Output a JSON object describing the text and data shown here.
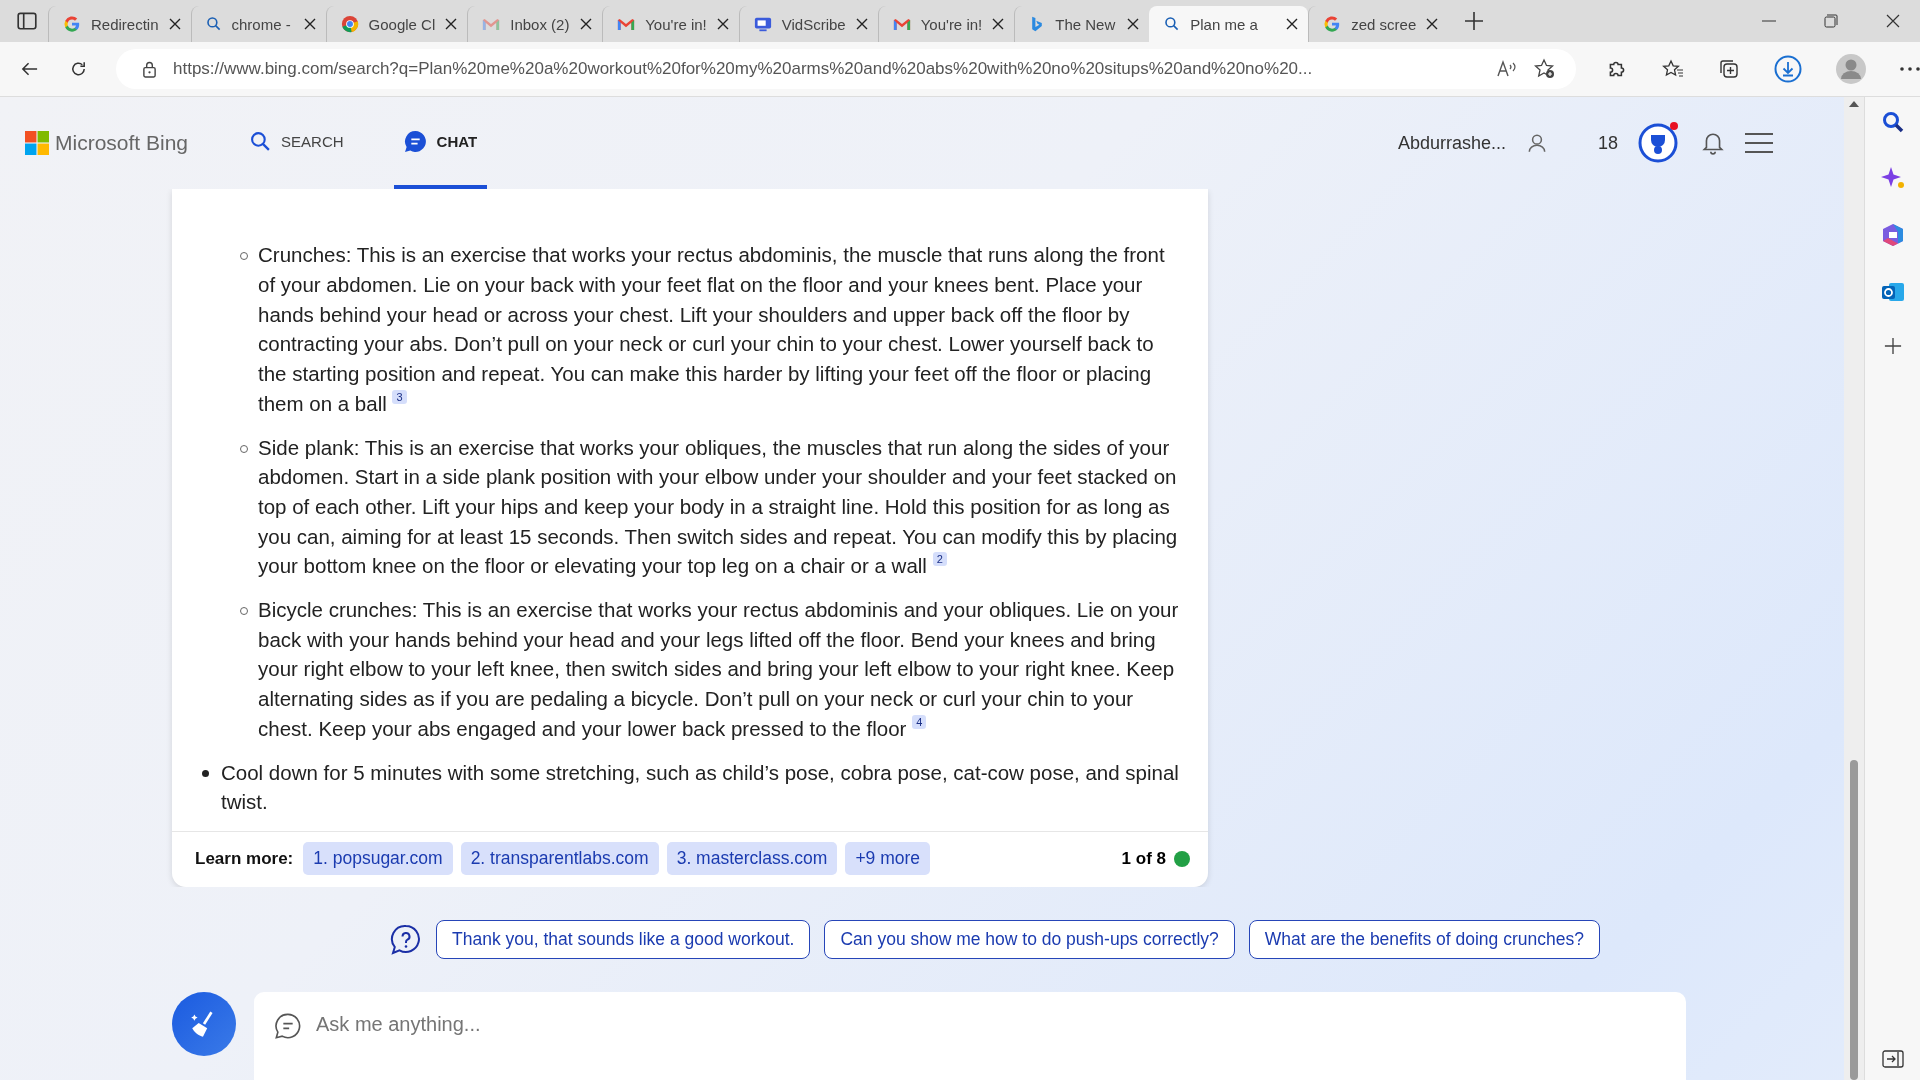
{
  "browser": {
    "tabs": [
      {
        "title": "Redirectin",
        "selected": false
      },
      {
        "title": "chrome -",
        "selected": false
      },
      {
        "title": "Google Cl",
        "selected": false
      },
      {
        "title": "Inbox (2)",
        "selected": false
      },
      {
        "title": "You're in!",
        "selected": false
      },
      {
        "title": "VidScribe",
        "selected": false
      },
      {
        "title": "You're in!",
        "selected": false
      },
      {
        "title": "The New",
        "selected": false
      },
      {
        "title": "Plan me a",
        "selected": true
      },
      {
        "title": "zed scree",
        "selected": false
      }
    ],
    "url": "https://www.bing.com/search?q=Plan%20me%20a%20workout%20for%20my%20arms%20and%20abs%20with%20no%20situps%20and%20no%20..."
  },
  "header": {
    "logo": "Microsoft Bing",
    "nav": [
      {
        "label": "SEARCH",
        "kind": "search",
        "selected": false
      },
      {
        "label": "CHAT",
        "kind": "chat",
        "selected": true
      }
    ],
    "user": "Abdurrashe...",
    "points": "18"
  },
  "answer": {
    "sub_items": [
      {
        "text": "Crunches: This is an exercise that works your rectus abdominis, the muscle that runs along the front of your abdomen. Lie on your back with your feet flat on the floor and your knees bent. Place your hands behind your head or across your chest. Lift your shoulders and upper back off the floor by contracting your abs. Don’t pull on your neck or curl your chin to your chest. Lower yourself back to the starting position and repeat. You can make this harder by lifting your feet off the floor or placing them on a ball",
        "cite": "3"
      },
      {
        "text": "Side plank: This is an exercise that works your obliques, the muscles that run along the sides of your abdomen. Start in a side plank position with your elbow under your shoulder and your feet stacked on top of each other. Lift your hips and keep your body in a straight line. Hold this position for as long as you can, aiming for at least 15 seconds. Then switch sides and repeat. You can modify this by placing your bottom knee on the floor or elevating your top leg on a chair or a wall",
        "cite": "2"
      },
      {
        "text": "Bicycle crunches: This is an exercise that works your rectus abdominis and your obliques. Lie on your back with your hands behind your head and your legs lifted off the floor. Bend your knees and bring your right elbow to your left knee, then switch sides and bring your left elbow to your right knee. Keep alternating sides as if you are pedaling a bicycle. Don’t pull on your neck or curl your chin to your chest. Keep your abs engaged and your lower back pressed to the floor",
        "cite": "4"
      }
    ],
    "items": [
      "Cool down for 5 minutes with some stretching, such as child’s pose, cobra pose, cat-cow pose, and spinal twist."
    ],
    "learn_more_label": "Learn more:",
    "links": [
      "1. popsugar.com",
      "2. transparentlabs.com",
      "3. masterclass.com",
      "+9 more"
    ],
    "counter": "1 of 8"
  },
  "suggestions": [
    "Thank you, that sounds like a good workout.",
    "Can you show me how to do push-ups correctly?",
    "What are the benefits of doing crunches?"
  ],
  "input": {
    "placeholder": "Ask me anything..."
  }
}
